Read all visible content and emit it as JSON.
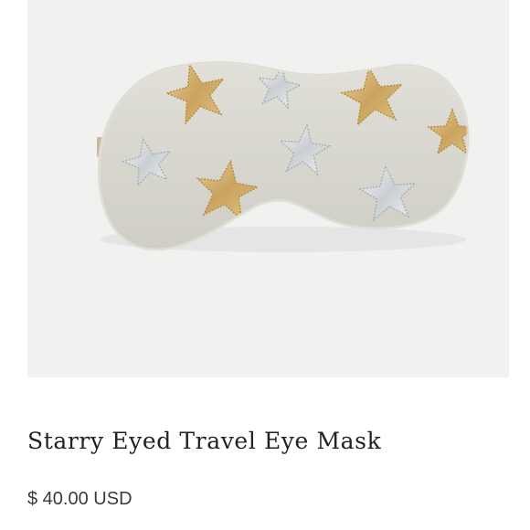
{
  "product": {
    "title": "Starry Eyed Travel Eye Mask",
    "price": "$ 40.00 USD",
    "image": {
      "subject": "sleep-eye-mask-with-stars",
      "colors": {
        "background": "#f1f1f0",
        "mask": "#dcdbd2",
        "gold_star": "#d4ad6a",
        "silver_star": "#d9dde0"
      }
    }
  }
}
